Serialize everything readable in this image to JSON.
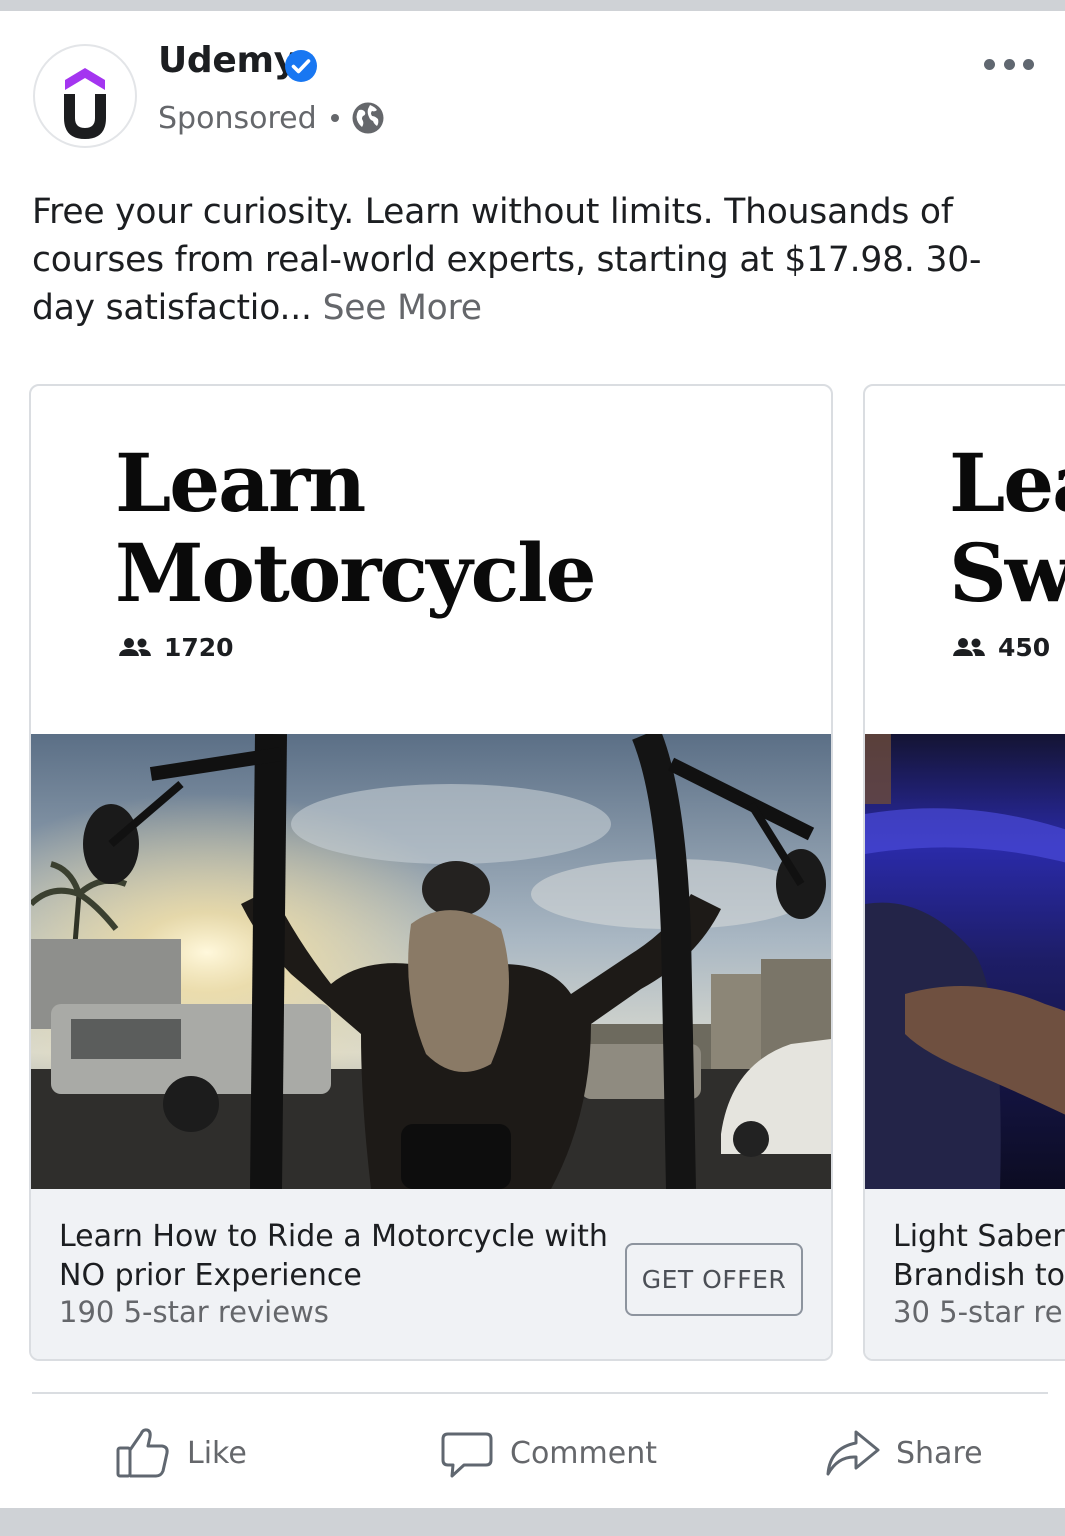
{
  "post": {
    "page_name": "Udemy",
    "sponsored_label": "Sponsored",
    "text": "Free your curiosity. Learn without limits. Thousands of courses from real-world experts, starting at $17.98. 30-day satisfactio...",
    "see_more_label": "See More"
  },
  "icons": {
    "avatar": "udemy-logo",
    "verified": "verified-badge-icon",
    "audience": "globe-icon",
    "more": "more-options-icon",
    "students": "people-icon"
  },
  "colors": {
    "verified_blue": "#1877f2",
    "udemy_purple": "#a435f0",
    "secondary_text": "#65676b",
    "card_footer_bg": "#f0f2f5"
  },
  "carousel": [
    {
      "title_line1": "Learn",
      "title_line2": "Motorcycle",
      "students": "1720",
      "course_line1": "Learn How to Ride a Motorcycle with",
      "course_line2": "NO prior Experience",
      "reviews": "190 5-star reviews",
      "button_label": "GET OFFER"
    },
    {
      "title_line1": "Lea",
      "title_line2": "Sw",
      "students": "450",
      "course_line1": "Light Saber",
      "course_line2": "Brandish to",
      "reviews": "30 5-star re"
    }
  ],
  "actions": {
    "like_label": "Like",
    "comment_label": "Comment",
    "share_label": "Share"
  }
}
